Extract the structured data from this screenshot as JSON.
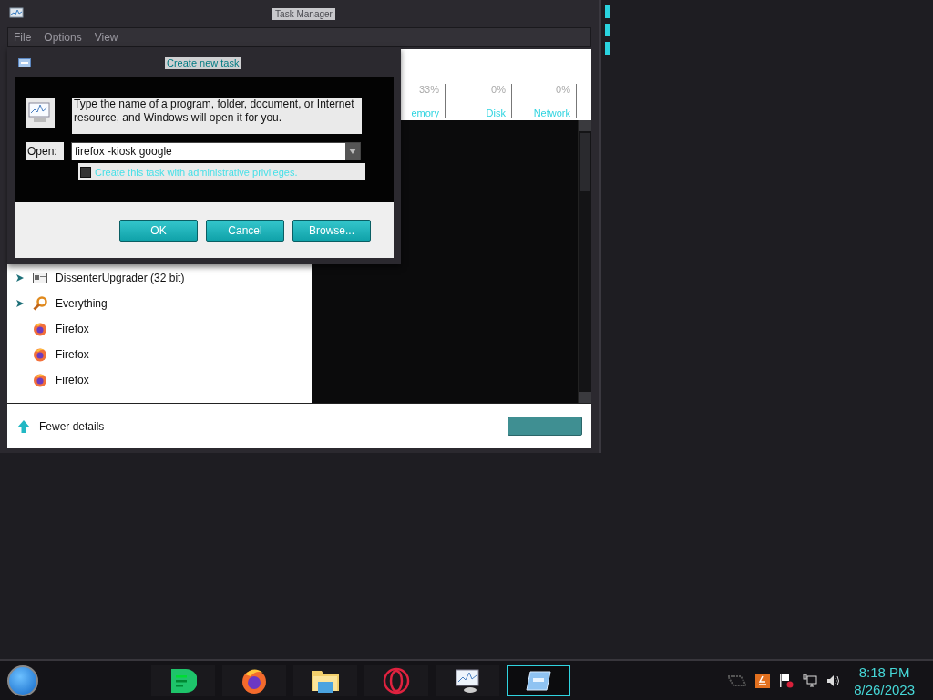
{
  "task_manager": {
    "title": "Task Manager",
    "menu": [
      "File",
      "Options",
      "View"
    ],
    "columns": [
      {
        "percent": "33%",
        "label": "emory"
      },
      {
        "percent": "0%",
        "label": "Disk"
      },
      {
        "percent": "0%",
        "label": "Network"
      }
    ],
    "processes": [
      {
        "name": "DissenterUpgrader (32 bit)",
        "kind": "window",
        "expandable": true
      },
      {
        "name": "Everything",
        "kind": "search",
        "expandable": true
      },
      {
        "name": "Firefox",
        "kind": "firefox",
        "expandable": false
      },
      {
        "name": "Firefox",
        "kind": "firefox",
        "expandable": false
      },
      {
        "name": "Firefox",
        "kind": "firefox",
        "expandable": false
      }
    ],
    "fewer_details": "Fewer details"
  },
  "dialog": {
    "title": "Create new task",
    "description": "Type the name of a program, folder, document, or Internet resource, and Windows will open it for you.",
    "open_label": "Open:",
    "open_value": "firefox -kiosk google",
    "admin_checkbox": {
      "label": "Create this task with administrative privileges.",
      "checked": false
    },
    "buttons": [
      "OK",
      "Cancel",
      "Browse..."
    ]
  },
  "taskbar": {
    "apps": [
      {
        "kind": "note",
        "selected": false
      },
      {
        "kind": "firefox",
        "selected": false
      },
      {
        "kind": "folder",
        "selected": false
      },
      {
        "kind": "opera",
        "selected": false
      },
      {
        "kind": "monitor",
        "selected": false
      },
      {
        "kind": "card",
        "selected": true
      }
    ],
    "tray": [
      {
        "kind": "grid"
      },
      {
        "kind": "orange"
      },
      {
        "kind": "flag"
      },
      {
        "kind": "network"
      },
      {
        "kind": "speaker"
      }
    ],
    "clock": {
      "time": "8:18 PM",
      "date": "8/26/2023"
    }
  }
}
